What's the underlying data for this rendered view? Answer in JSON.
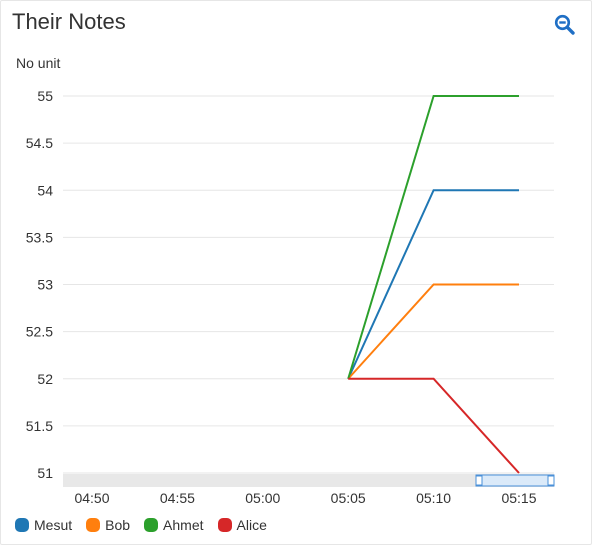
{
  "header": {
    "title": "Their Notes",
    "zoom_icon": "magnifier-minus-icon"
  },
  "chart_data": {
    "type": "line",
    "title": "Their Notes",
    "ylabel": "No unit",
    "xlabel": "",
    "x": [
      "05:05",
      "05:10",
      "05:15"
    ],
    "x_ticks": [
      "04:50",
      "04:55",
      "05:00",
      "05:05",
      "05:10",
      "05:15"
    ],
    "y_ticks": [
      "51",
      "51.5",
      "52",
      "52.5",
      "53",
      "53.5",
      "54",
      "54.5",
      "55"
    ],
    "ylim": [
      51,
      55
    ],
    "grid": true,
    "legend_position": "bottom-left",
    "series": [
      {
        "name": "Mesut",
        "color": "#1f77b4",
        "values": [
          52,
          54,
          54
        ]
      },
      {
        "name": "Bob",
        "color": "#ff7f0e",
        "values": [
          52,
          53,
          53
        ]
      },
      {
        "name": "Ahmet",
        "color": "#2ca02c",
        "values": [
          52,
          55,
          55
        ]
      },
      {
        "name": "Alice",
        "color": "#d62728",
        "values": [
          52,
          52,
          51
        ]
      }
    ]
  }
}
